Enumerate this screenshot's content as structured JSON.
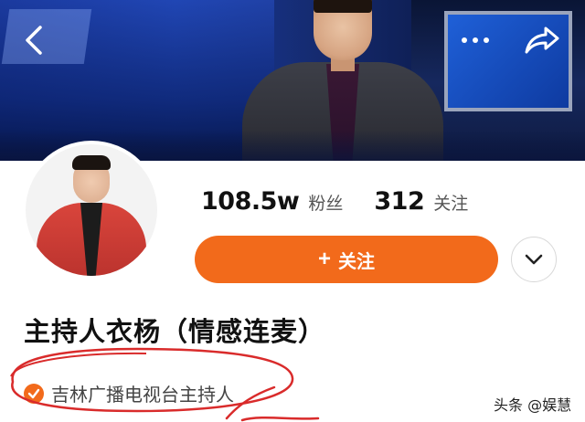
{
  "header": {
    "back_icon": "back-chevron-icon",
    "more_icon": "more-dots-icon",
    "share_icon": "share-arrow-icon"
  },
  "profile": {
    "followers_count": "108.5w",
    "followers_label": "粉丝",
    "following_count": "312",
    "following_label": "关注",
    "follow_button": {
      "plus": "+",
      "label": "关注"
    },
    "dropdown_icon": "chevron-down-icon",
    "name": "主持人衣杨（情感连麦）",
    "verification": {
      "icon": "verified-check-icon",
      "text": "吉林广播电视台主持人"
    }
  },
  "watermark": "头条 @娱慧",
  "colors": {
    "accent": "#f26a1b",
    "annotation": "#d92b2b",
    "text_primary": "#111111",
    "text_secondary": "#555555"
  }
}
